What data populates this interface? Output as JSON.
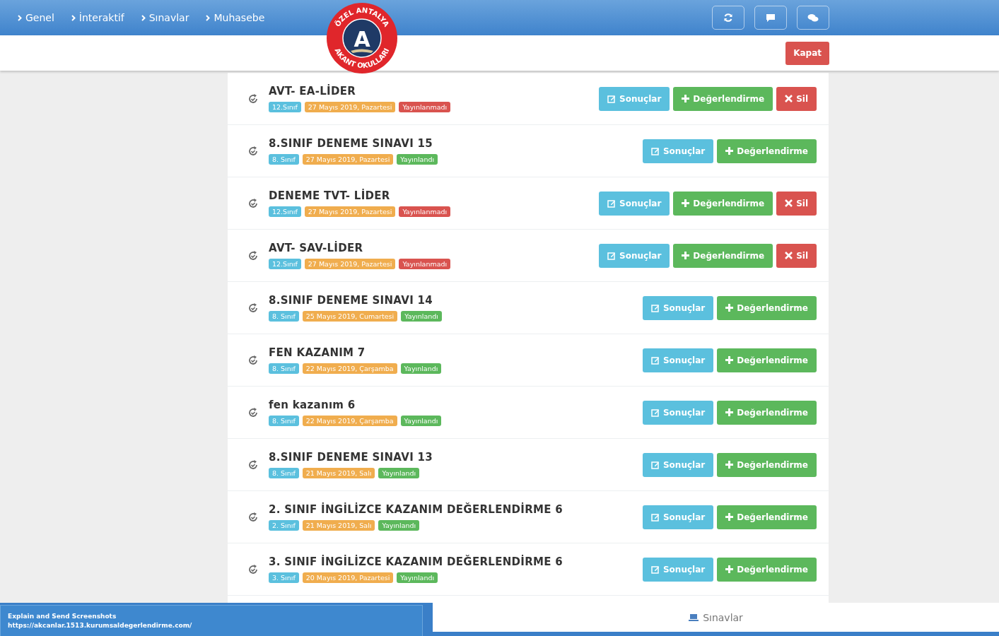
{
  "nav": [
    {
      "label": "Genel"
    },
    {
      "label": "İnteraktif"
    },
    {
      "label": "Sınavlar"
    },
    {
      "label": "Muhasebe"
    }
  ],
  "logo": {
    "top": "ÖZEL ANTALYA",
    "bottom": "AKANT OKULLARI",
    "letter": "A"
  },
  "toolbar": [
    {
      "kind": "refresh"
    },
    {
      "kind": "message"
    },
    {
      "kind": "chat"
    }
  ],
  "close_button": "Kapat",
  "exams": [
    {
      "title": "AVT- EA-LİDER",
      "tags": [
        {
          "text": "12.Sınıf",
          "color": "#5bc0de"
        },
        {
          "text": "27 Mayıs 2019, Pazartesi",
          "color": "#f0ad4e"
        },
        {
          "text": "Yayınlanmadı",
          "color": "#d9534f"
        }
      ],
      "buttons": [
        {
          "kind": "results",
          "label": "Sonuçlar"
        },
        {
          "kind": "evaluate",
          "label": "Değerlendirme"
        },
        {
          "kind": "delete",
          "label": "Sil"
        }
      ]
    },
    {
      "title": "8.SINIF DENEME SINAVI 15",
      "tags": [
        {
          "text": "8. Sınıf",
          "color": "#5bc0de"
        },
        {
          "text": "27 Mayıs 2019, Pazartesi",
          "color": "#f0ad4e"
        },
        {
          "text": "Yayınlandı",
          "color": "#5cb85c"
        }
      ],
      "buttons": [
        {
          "kind": "results",
          "label": "Sonuçlar"
        },
        {
          "kind": "evaluate",
          "label": "Değerlendirme"
        }
      ]
    },
    {
      "title": "DENEME TVT- LİDER",
      "tags": [
        {
          "text": "12.Sınıf",
          "color": "#5bc0de"
        },
        {
          "text": "27 Mayıs 2019, Pazartesi",
          "color": "#f0ad4e"
        },
        {
          "text": "Yayınlanmadı",
          "color": "#d9534f"
        }
      ],
      "buttons": [
        {
          "kind": "results",
          "label": "Sonuçlar"
        },
        {
          "kind": "evaluate",
          "label": "Değerlendirme"
        },
        {
          "kind": "delete",
          "label": "Sil"
        }
      ]
    },
    {
      "title": "AVT- SAV-LİDER",
      "tags": [
        {
          "text": "12.Sınıf",
          "color": "#5bc0de"
        },
        {
          "text": "27 Mayıs 2019, Pazartesi",
          "color": "#f0ad4e"
        },
        {
          "text": "Yayınlanmadı",
          "color": "#d9534f"
        }
      ],
      "buttons": [
        {
          "kind": "results",
          "label": "Sonuçlar"
        },
        {
          "kind": "evaluate",
          "label": "Değerlendirme"
        },
        {
          "kind": "delete",
          "label": "Sil"
        }
      ]
    },
    {
      "title": "8.SINIF DENEME SINAVI 14",
      "tags": [
        {
          "text": "8. Sınıf",
          "color": "#5bc0de"
        },
        {
          "text": "25 Mayıs 2019, Cumartesi",
          "color": "#f0ad4e"
        },
        {
          "text": "Yayınlandı",
          "color": "#5cb85c"
        }
      ],
      "buttons": [
        {
          "kind": "results",
          "label": "Sonuçlar"
        },
        {
          "kind": "evaluate",
          "label": "Değerlendirme"
        }
      ]
    },
    {
      "title": "FEN KAZANIM 7",
      "tags": [
        {
          "text": "8. Sınıf",
          "color": "#5bc0de"
        },
        {
          "text": "22 Mayıs 2019, Çarşamba",
          "color": "#f0ad4e"
        },
        {
          "text": "Yayınlandı",
          "color": "#5cb85c"
        }
      ],
      "buttons": [
        {
          "kind": "results",
          "label": "Sonuçlar"
        },
        {
          "kind": "evaluate",
          "label": "Değerlendirme"
        }
      ]
    },
    {
      "title": "fen kazanım 6",
      "tags": [
        {
          "text": "8. Sınıf",
          "color": "#5bc0de"
        },
        {
          "text": "22 Mayıs 2019, Çarşamba",
          "color": "#f0ad4e"
        },
        {
          "text": "Yayınlandı",
          "color": "#5cb85c"
        }
      ],
      "buttons": [
        {
          "kind": "results",
          "label": "Sonuçlar"
        },
        {
          "kind": "evaluate",
          "label": "Değerlendirme"
        }
      ]
    },
    {
      "title": "8.SINIF DENEME SINAVI 13",
      "tags": [
        {
          "text": "8. Sınıf",
          "color": "#5bc0de"
        },
        {
          "text": "21 Mayıs 2019, Salı",
          "color": "#f0ad4e"
        },
        {
          "text": "Yayınlandı",
          "color": "#5cb85c"
        }
      ],
      "buttons": [
        {
          "kind": "results",
          "label": "Sonuçlar"
        },
        {
          "kind": "evaluate",
          "label": "Değerlendirme"
        }
      ]
    },
    {
      "title": "2. SINIF İNGİLİZCE KAZANIM DEĞERLENDİRME 6",
      "tags": [
        {
          "text": "2. Sınıf",
          "color": "#5bc0de"
        },
        {
          "text": "21 Mayıs 2019, Salı",
          "color": "#f0ad4e"
        },
        {
          "text": "Yayınlandı",
          "color": "#5cb85c"
        }
      ],
      "buttons": [
        {
          "kind": "results",
          "label": "Sonuçlar"
        },
        {
          "kind": "evaluate",
          "label": "Değerlendirme"
        }
      ]
    },
    {
      "title": "3. SINIF İNGİLİZCE KAZANIM DEĞERLENDİRME 6",
      "tags": [
        {
          "text": "3. Sınıf",
          "color": "#5bc0de"
        },
        {
          "text": "20 Mayıs 2019, Pazartesi",
          "color": "#f0ad4e"
        },
        {
          "text": "Yayınlandı",
          "color": "#5cb85c"
        }
      ],
      "buttons": [
        {
          "kind": "results",
          "label": "Sonuçlar"
        },
        {
          "kind": "evaluate",
          "label": "Değerlendirme"
        }
      ]
    }
  ],
  "footer": {
    "lines": [
      "Explain and Send Screenshots",
      "https://akcanlar.1513.kurumsaldegerlendirme.com/"
    ],
    "tab": "Sınavlar"
  }
}
